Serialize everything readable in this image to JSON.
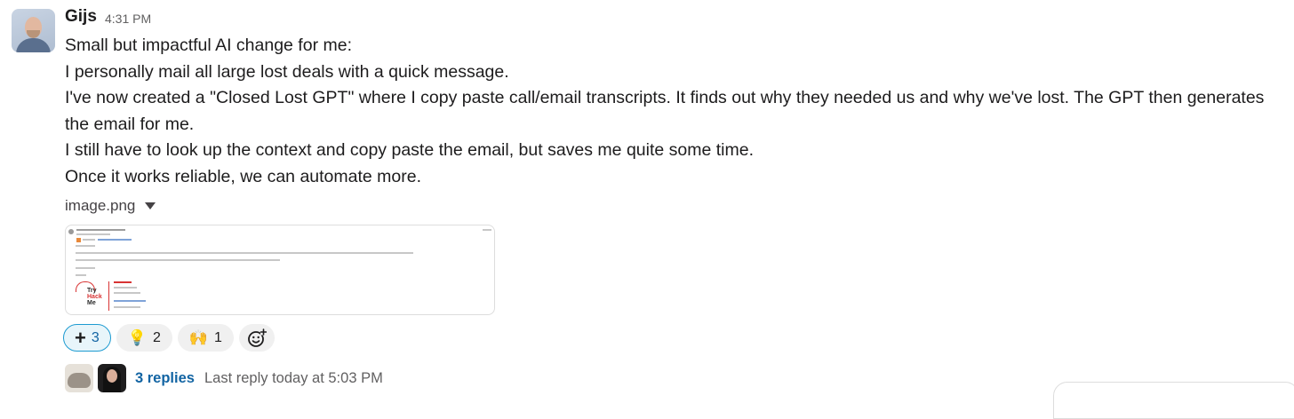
{
  "message": {
    "author": "Gijs",
    "time": "4:31 PM",
    "lines": [
      "Small but impactful AI change for me:",
      "I personally mail all large lost deals with a quick message.",
      "I've now created a \"Closed Lost GPT\" where I copy paste call/email transcripts. It finds out why they needed us and why we've lost. The GPT then generates the email for me.",
      "I still have to look up the context and copy paste the email, but saves me quite some time.",
      "Once it works reliable, we can automate more."
    ]
  },
  "attachment": {
    "filename": "image.png",
    "preview": {
      "logo_lines": [
        "Try",
        "Hack",
        "Me"
      ]
    }
  },
  "reactions": [
    {
      "icon": "plus-one",
      "glyph": "+",
      "count": "3",
      "active": true
    },
    {
      "icon": "light-bulb",
      "glyph": "💡",
      "count": "2",
      "active": false
    },
    {
      "icon": "raised-hands",
      "glyph": "🙌",
      "count": "1",
      "active": false
    }
  ],
  "add_reaction": {
    "icon": "add-reaction-icon"
  },
  "thread": {
    "reply_count": "3 replies",
    "last_reply": "Last reply today at 5:03 PM"
  }
}
